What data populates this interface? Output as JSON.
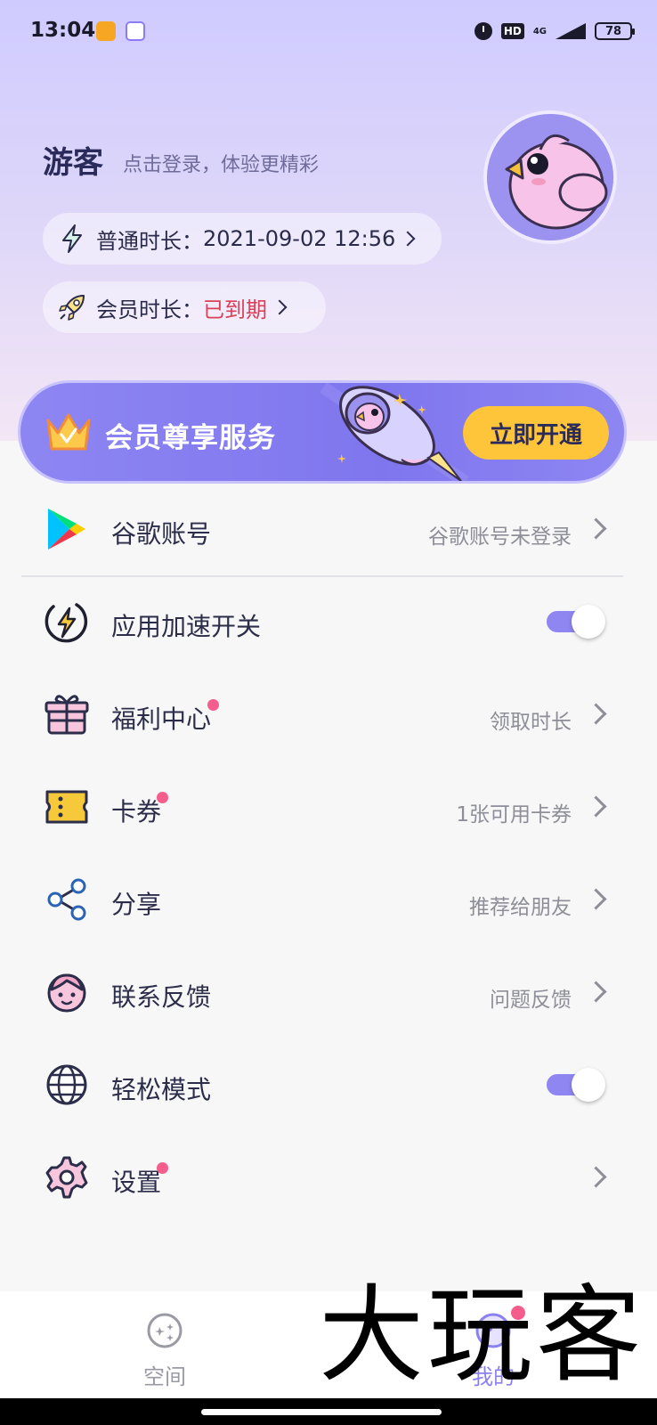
{
  "status_bar": {
    "time": "13:04",
    "hd": "HD",
    "network": "4G",
    "battery": "78"
  },
  "profile": {
    "name": "游客",
    "login_hint": "点击登录，体验更精彩",
    "normal_duration_label": "普通时长：",
    "normal_duration_value": "2021-09-02 12:56",
    "member_duration_label": "会员时长：",
    "member_duration_value": "已到期"
  },
  "vip_banner": {
    "title": "会员尊享服务",
    "button_label": "立即开通"
  },
  "menu": {
    "google": {
      "label": "谷歌账号",
      "value": "谷歌账号未登录",
      "icon": "google-play-icon"
    },
    "acceleration": {
      "label": "应用加速开关",
      "toggle_on": true,
      "icon": "lightning-icon"
    },
    "welfare": {
      "label": "福利中心",
      "value": "领取时长",
      "has_dot": true,
      "icon": "gift-icon"
    },
    "coupon": {
      "label": "卡券",
      "value": "1张可用卡券",
      "has_dot": true,
      "icon": "ticket-icon"
    },
    "share": {
      "label": "分享",
      "value": "推荐给朋友",
      "icon": "share-icon"
    },
    "feedback": {
      "label": "联系反馈",
      "value": "问题反馈",
      "icon": "support-agent-icon"
    },
    "easy_mode": {
      "label": "轻松模式",
      "toggle_on": true,
      "icon": "globe-icon"
    },
    "settings": {
      "label": "设置",
      "has_dot": true,
      "icon": "gear-icon"
    }
  },
  "bottom_nav": {
    "space": "空间",
    "mine": "我的"
  },
  "watermark": "大玩客",
  "colors": {
    "accent": "#8a80ef",
    "expired": "#d9425a",
    "vip_button": "#fec53a",
    "badge": "#f55d8c"
  }
}
